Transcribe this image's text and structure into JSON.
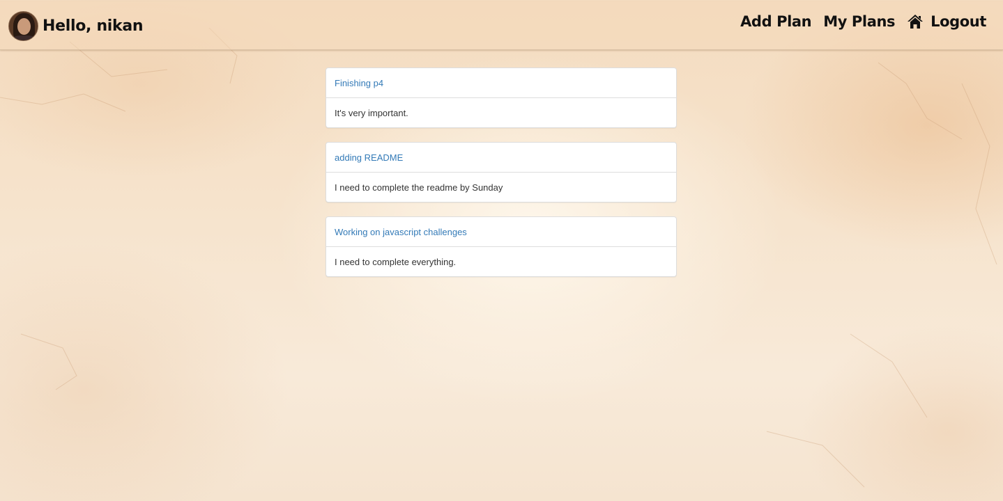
{
  "navbar": {
    "greeting": "Hello, nikan",
    "links": [
      {
        "label": "Add Plan"
      },
      {
        "label": "My Plans"
      },
      {
        "label": "Logout",
        "icon": "home-icon"
      }
    ]
  },
  "plans": [
    {
      "title": "Finishing p4",
      "description": "It's very important."
    },
    {
      "title": "adding README",
      "description": "I need to complete the readme by Sunday"
    },
    {
      "title": "Working on javascript challenges",
      "description": "I need to complete everything."
    }
  ],
  "colors": {
    "link": "#337ab7",
    "text": "#333333",
    "nav_text": "#111111"
  }
}
